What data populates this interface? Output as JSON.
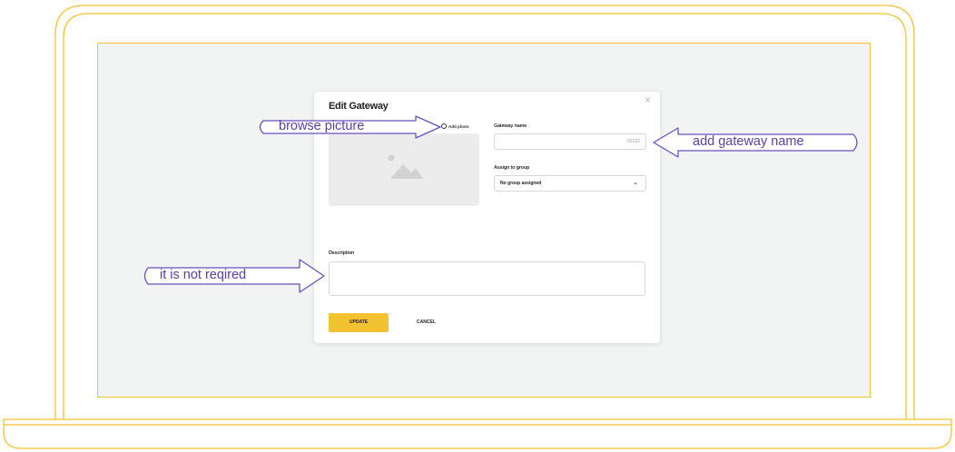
{
  "modal": {
    "title": "Edit Gateway",
    "close_glyph": "×",
    "add_photo_label": "Add photo",
    "gateway_name_label": "Gateway name",
    "gateway_name_value": "02122",
    "assign_group_label": "Assign to group",
    "assign_group_value": "No group assigned",
    "description_label": "Description",
    "description_value": "",
    "update_label": "UPDATE",
    "cancel_label": "CANCEL"
  },
  "annotations": {
    "browse_picture": "browse picture",
    "add_gateway_name": "add gateway name",
    "not_required": "it is not reqired"
  },
  "icons": {
    "placeholder_image": "image-placeholder-icon",
    "camera": "camera-icon",
    "select_chevron": "chevron-down-icon",
    "close": "close-icon"
  },
  "colors": {
    "laptop_outline": "#f2c230",
    "screen_bg": "#f1f4f2",
    "accent": "#f2c230",
    "callout": "#5a3fa8"
  }
}
